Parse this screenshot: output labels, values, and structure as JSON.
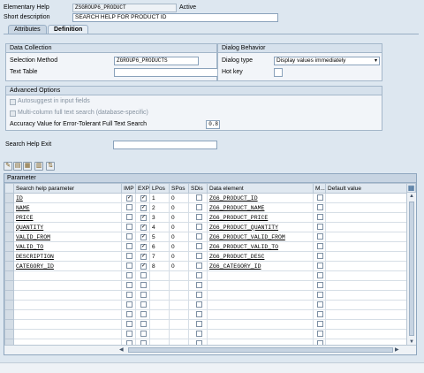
{
  "header": {
    "elem_help_label": "Elementary Help",
    "elem_help_value": "ZSGROUP6_PRODUCT",
    "status": "Active",
    "short_desc_label": "Short description",
    "short_desc_value": "SEARCH HELP FOR PRODUCT ID"
  },
  "tabs": [
    {
      "label": "Attributes",
      "active": false
    },
    {
      "label": "Definition",
      "active": true
    }
  ],
  "data_collection": {
    "title": "Data Collection",
    "selection_method_label": "Selection Method",
    "selection_method_value": "ZGROUP6_PRODUCTS",
    "text_table_label": "Text Table",
    "text_table_value": ""
  },
  "dialog_behavior": {
    "title": "Dialog Behavior",
    "dialog_type_label": "Dialog type",
    "dialog_type_value": "Display values immediately",
    "hot_key_label": "Hot key",
    "hot_key_value": ""
  },
  "advanced": {
    "title": "Advanced Options",
    "autosuggest_label": "Autosuggest in input fields",
    "multicolumn_label": "Multi-column full text search (database-specific)",
    "accuracy_label": "Accuracy Value for Error-Tolerant Full Text Search",
    "accuracy_value": "0.8"
  },
  "exit": {
    "label": "Search Help Exit",
    "value": ""
  },
  "parameter": {
    "title": "Parameter",
    "columns": [
      "Search help parameter",
      "IMP",
      "EXP",
      "LPos",
      "SPos",
      "SDis",
      "Data element",
      "M...",
      "Default value"
    ],
    "rows": [
      {
        "name": "ID",
        "imp": true,
        "exp": true,
        "lpos": "1",
        "spos": "0",
        "sdis": false,
        "element": "ZG6_PRODUCT_ID",
        "m": false,
        "default": ""
      },
      {
        "name": "NAME",
        "imp": false,
        "exp": true,
        "lpos": "2",
        "spos": "0",
        "sdis": false,
        "element": "ZG6_PRODUCT_NAME",
        "m": false,
        "default": ""
      },
      {
        "name": "PRICE",
        "imp": false,
        "exp": true,
        "lpos": "3",
        "spos": "0",
        "sdis": false,
        "element": "ZG6_PRODUCT_PRICE",
        "m": false,
        "default": ""
      },
      {
        "name": "QUANTITY",
        "imp": false,
        "exp": true,
        "lpos": "4",
        "spos": "0",
        "sdis": false,
        "element": "ZG6_PRODUCT_QUANTITY",
        "m": false,
        "default": ""
      },
      {
        "name": "VALID_FROM",
        "imp": false,
        "exp": true,
        "lpos": "5",
        "spos": "0",
        "sdis": false,
        "element": "ZG6_PRODUCT_VALID_FROM",
        "m": false,
        "default": ""
      },
      {
        "name": "VALID_TO",
        "imp": false,
        "exp": true,
        "lpos": "6",
        "spos": "0",
        "sdis": false,
        "element": "ZG6_PRODUCT_VALID_TO",
        "m": false,
        "default": ""
      },
      {
        "name": "DESCRIPTION",
        "imp": false,
        "exp": true,
        "lpos": "7",
        "spos": "0",
        "sdis": false,
        "element": "ZG6_PRODUCT_DESC",
        "m": false,
        "default": ""
      },
      {
        "name": "CATEGORY_ID",
        "imp": false,
        "exp": true,
        "lpos": "8",
        "spos": "0",
        "sdis": false,
        "element": "ZG6_CATEGORY_ID",
        "m": false,
        "default": ""
      }
    ],
    "empty_rows": 9
  },
  "icons": {
    "toolbar": [
      "insert-row-icon",
      "delete-row-icon",
      "copy-row-icon",
      "paste-row-icon",
      "sort-icon"
    ],
    "settings": "table-settings-icon"
  },
  "colors": {
    "background": "#dde7f0",
    "panel_title": "#d6e1ec",
    "grid_header": "#e0e8f0"
  }
}
